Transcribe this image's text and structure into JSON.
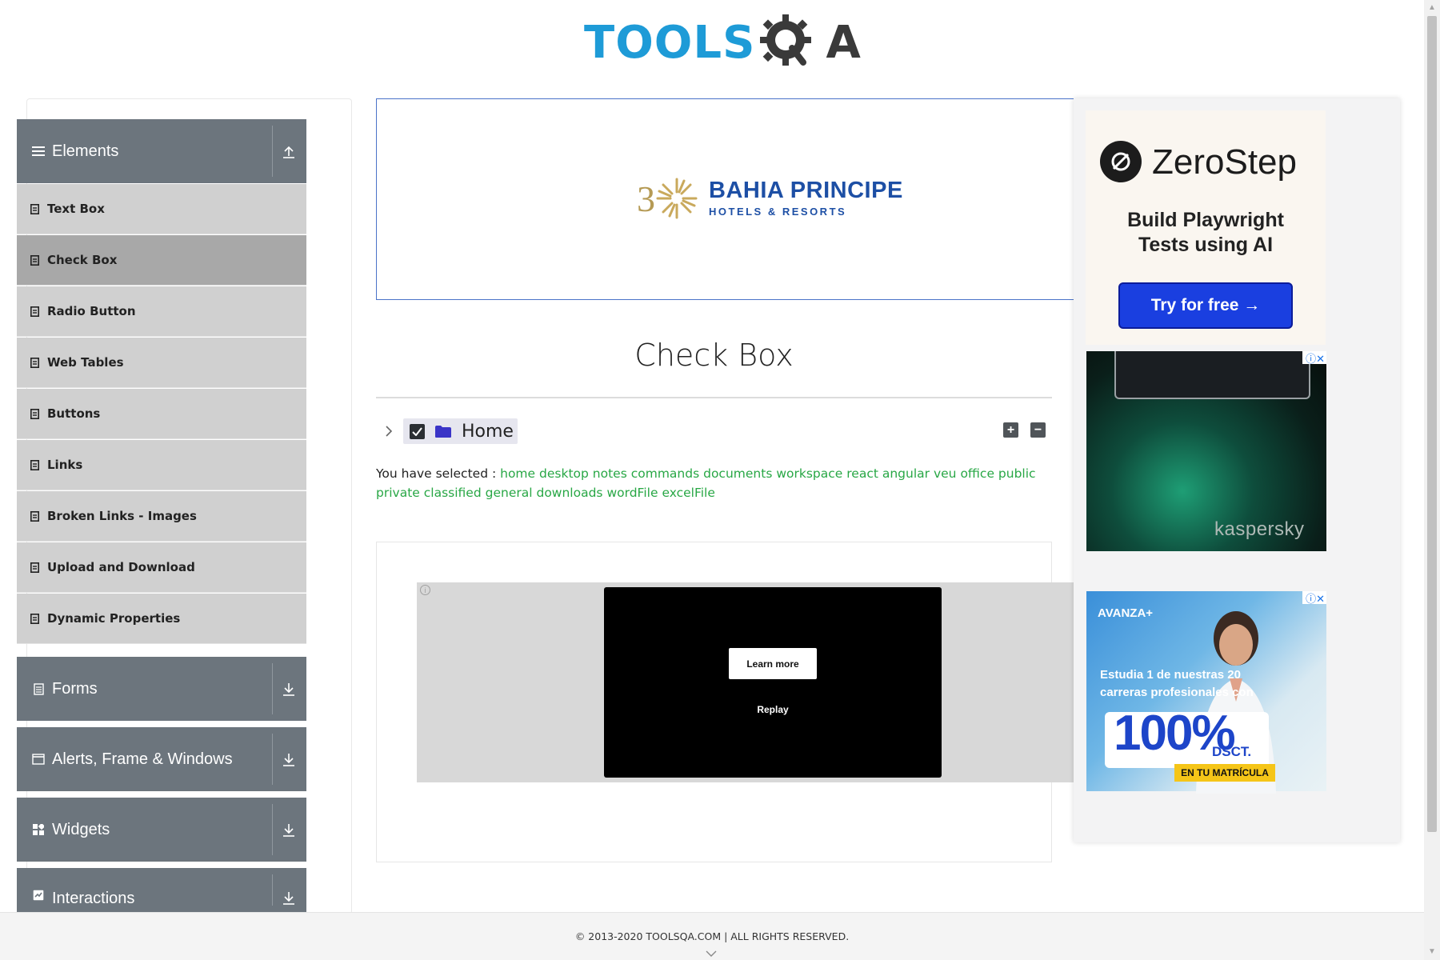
{
  "brand": {
    "logo_text": "TOOLS",
    "logo_suffix": "A",
    "logo_color": "#1e9bd7"
  },
  "sidebar": {
    "groups": [
      {
        "label": "Elements",
        "icon": "hamburger-icon",
        "state": "expanded",
        "arrow": "collapse-arrow-icon"
      },
      {
        "label": "Forms",
        "icon": "form-icon",
        "state": "collapsed",
        "arrow": "expand-arrow-icon"
      },
      {
        "label": "Alerts, Frame & Windows",
        "icon": "window-icon",
        "state": "collapsed",
        "arrow": "expand-arrow-icon"
      },
      {
        "label": "Widgets",
        "icon": "widgets-icon",
        "state": "collapsed",
        "arrow": "expand-arrow-icon"
      },
      {
        "label": "Interactions",
        "icon": "interactions-icon",
        "state": "collapsed",
        "arrow": "expand-arrow-icon"
      }
    ],
    "items": [
      {
        "label": "Text Box",
        "active": false
      },
      {
        "label": "Check Box",
        "active": true
      },
      {
        "label": "Radio Button",
        "active": false
      },
      {
        "label": "Web Tables",
        "active": false
      },
      {
        "label": "Buttons",
        "active": false
      },
      {
        "label": "Links",
        "active": false
      },
      {
        "label": "Broken Links - Images",
        "active": false
      },
      {
        "label": "Upload and Download",
        "active": false
      },
      {
        "label": "Dynamic Properties",
        "active": false
      }
    ],
    "header_color": "#6c757d",
    "active_color": "#a8a8a8"
  },
  "banner_ad": {
    "brand": "BAHIA PRINCIPE",
    "tagline": "HOTELS & RESORTS",
    "color": "#1d4fa5"
  },
  "main": {
    "title": "Check Box",
    "tree": {
      "root_label": "Home",
      "root_checked": true,
      "expand_all": "+",
      "collapse_all": "−"
    },
    "result_prefix": "You have selected :",
    "selected": [
      "home",
      "desktop",
      "notes",
      "commands",
      "documents",
      "workspace",
      "react",
      "angular",
      "veu",
      "office",
      "public",
      "private",
      "classified",
      "general",
      "downloads",
      "wordFile",
      "excelFile"
    ],
    "selected_color": "#28a745"
  },
  "video_ad": {
    "learn_more": "Learn more",
    "replay": "Replay",
    "info": "i"
  },
  "right_ads": {
    "zerostep": {
      "name": "ZeroStep",
      "tagline_line1": "Build Playwright",
      "tagline_line2": "Tests using AI",
      "cta": "Try for free →",
      "cta_color": "#1a3fe0"
    },
    "kaspersky": {
      "brand": "kaspersky"
    },
    "avanza": {
      "brand": "AVANZA+",
      "line1": "Estudia 1 de nuestras 20",
      "line2": "carreras profesionales con",
      "percent": "100%",
      "dsct": "DSCT.",
      "band": "EN TU MATRÍCULA"
    }
  },
  "footer": {
    "text": "© 2013-2020 TOOLSQA.COM | ALL RIGHTS RESERVED."
  }
}
